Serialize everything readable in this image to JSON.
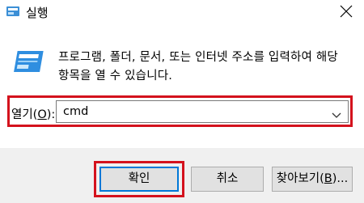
{
  "window": {
    "title": "실행",
    "close_icon": "close-icon"
  },
  "description": {
    "line1": "프로그램, 폴더, 문서, 또는 인터넷 주소를 입력하여 해당",
    "line2": "항목을 열 수 있습니다."
  },
  "open": {
    "label_prefix": "열기(",
    "label_mnemonic": "O",
    "label_suffix": "):",
    "value": "cmd"
  },
  "buttons": {
    "ok_label": "확인",
    "cancel_label": "취소",
    "browse_prefix": "찾아보기(",
    "browse_mnemonic": "B",
    "browse_suffix": ")..."
  },
  "colors": {
    "highlight": "#d4121d",
    "focus": "#0078d7",
    "footer_bg": "#f0f0f0",
    "button_bg": "#e1e1e1"
  }
}
